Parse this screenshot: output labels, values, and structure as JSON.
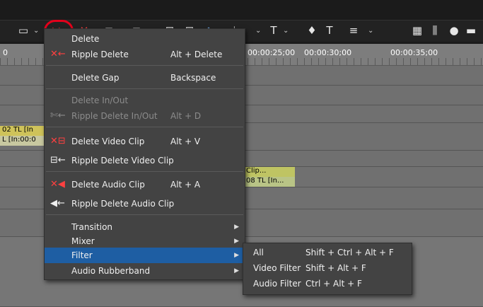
{
  "toolbar": {
    "buttons": [
      {
        "name": "clip-view-icon",
        "glyph": "▭"
      },
      {
        "name": "delete-icon",
        "glyph": "✕"
      },
      {
        "name": "ripple-delete-icon",
        "glyph": "✕"
      },
      {
        "name": "in-point-icon",
        "glyph": "⊐"
      },
      {
        "name": "out-point-icon",
        "glyph": "⊏"
      },
      {
        "name": "split-icon",
        "glyph": "⊞"
      },
      {
        "name": "trim-icon",
        "glyph": "⊟"
      },
      {
        "name": "marker-icon",
        "glyph": "◆"
      },
      {
        "name": "audio-icon",
        "glyph": "♩"
      },
      {
        "name": "title-icon",
        "glyph": "T"
      },
      {
        "name": "voice-icon",
        "glyph": "♦"
      },
      {
        "name": "mixer-icon",
        "glyph": "≡"
      },
      {
        "name": "grid-icon",
        "glyph": "▦"
      },
      {
        "name": "levels-icon",
        "glyph": "⫼"
      },
      {
        "name": "record-icon",
        "glyph": "●"
      },
      {
        "name": "window-icon",
        "glyph": "▬"
      }
    ]
  },
  "ruler": {
    "timecodes": [
      "00:00:25;00",
      "00:00:30;00",
      "00:00:35;00"
    ]
  },
  "clips": {
    "track1_a": "02  TL [In",
    "track1_b": "L [In:00:0",
    "track2_a": "Clip...",
    "track2_b": "08  TL [In..."
  },
  "menu": {
    "items": [
      {
        "label": "Delete",
        "shortcut": "",
        "disabled": false
      },
      {
        "label": "Ripple Delete",
        "shortcut": "Alt + Delete",
        "disabled": false
      },
      {
        "label": "Delete Gap",
        "shortcut": "Backspace",
        "disabled": false
      },
      {
        "label": "Delete In/Out",
        "shortcut": "",
        "disabled": true
      },
      {
        "label": "Ripple Delete In/Out",
        "shortcut": "Alt + D",
        "disabled": true
      },
      {
        "label": "Delete Video Clip",
        "shortcut": "Alt + V",
        "disabled": false
      },
      {
        "label": "Ripple Delete Video Clip",
        "shortcut": "",
        "disabled": false
      },
      {
        "label": "Delete Audio Clip",
        "shortcut": "Alt + A",
        "disabled": false
      },
      {
        "label": "Ripple Delete Audio Clip",
        "shortcut": "",
        "disabled": false
      },
      {
        "label": "Transition",
        "shortcut": "",
        "disabled": false
      },
      {
        "label": "Mixer",
        "shortcut": "",
        "disabled": false
      },
      {
        "label": "Filter",
        "shortcut": "",
        "disabled": false
      },
      {
        "label": "Audio Rubberband",
        "shortcut": "",
        "disabled": false
      }
    ]
  },
  "submenu": {
    "items": [
      {
        "label": "All",
        "shortcut": "Shift + Ctrl + Alt + F"
      },
      {
        "label": "Video Filter",
        "shortcut": "Shift + Alt + F"
      },
      {
        "label": "Audio Filter",
        "shortcut": "Ctrl + Alt + F"
      }
    ]
  },
  "colors": {
    "highlight": "#1e5ea3",
    "delete_red": "#e3001b"
  }
}
